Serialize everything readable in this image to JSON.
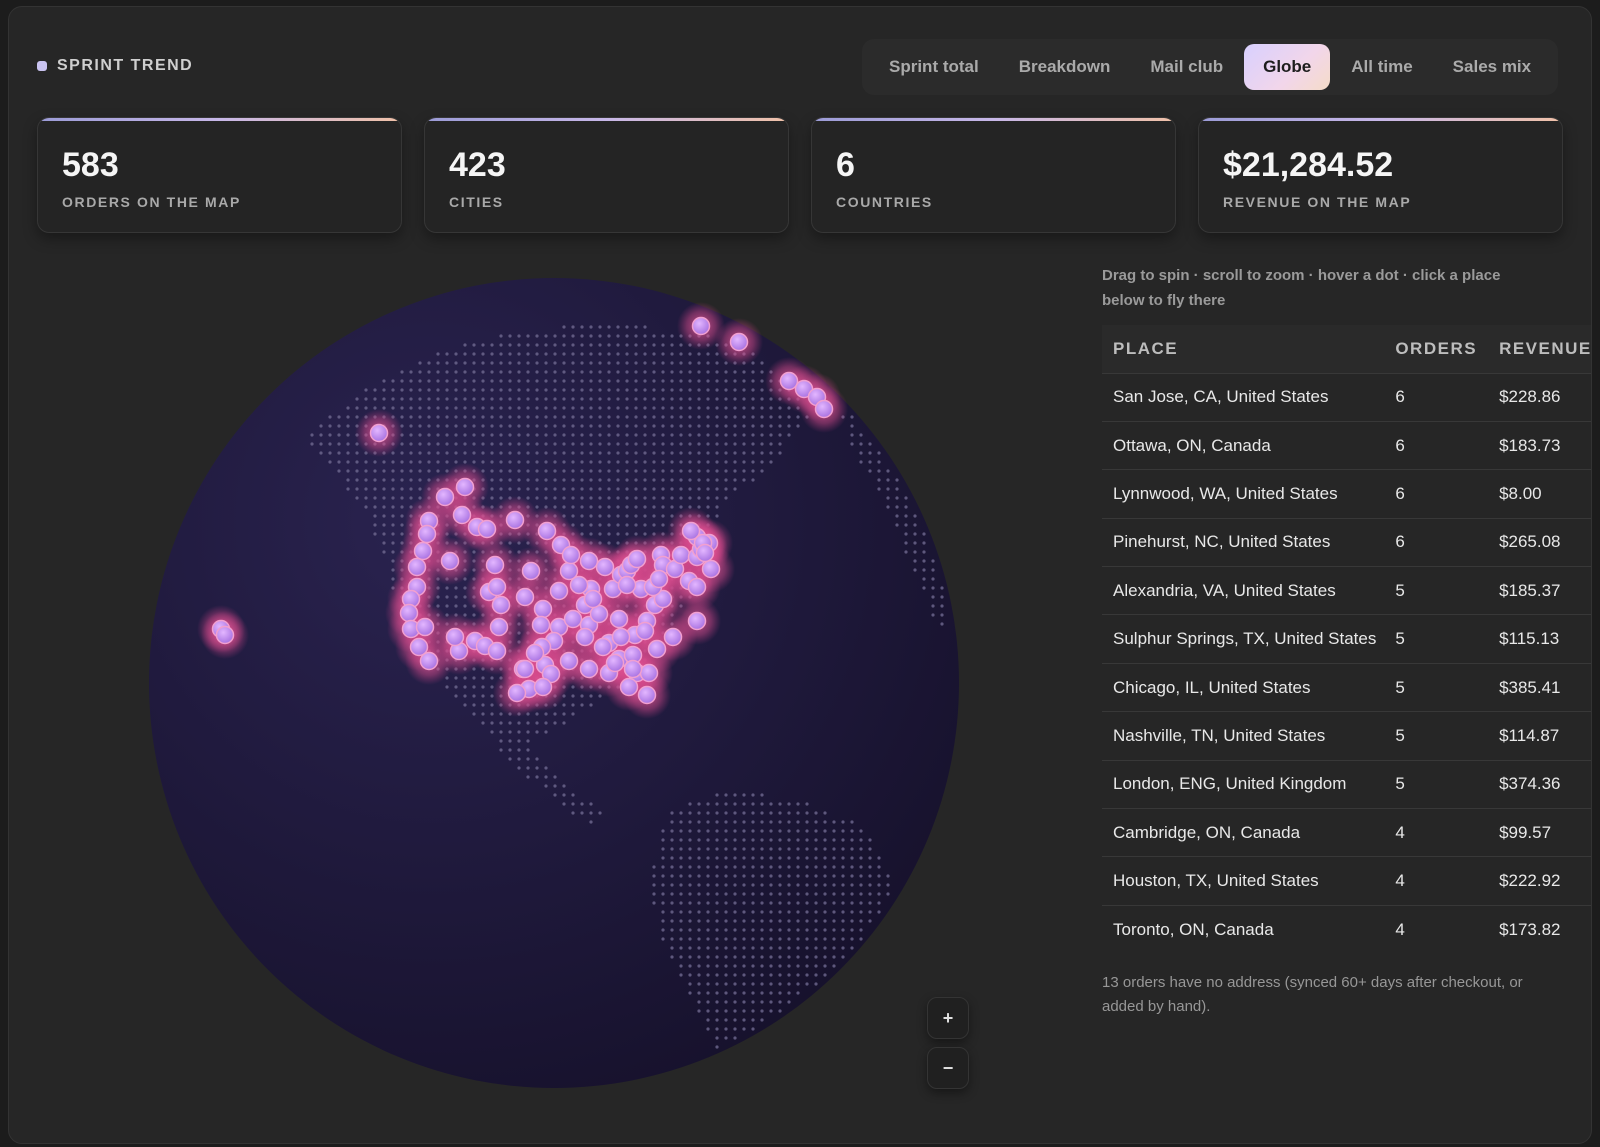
{
  "header": {
    "title": "SPRINT TREND"
  },
  "tabs": [
    {
      "label": "Sprint total",
      "active": false
    },
    {
      "label": "Breakdown",
      "active": false
    },
    {
      "label": "Mail club",
      "active": false
    },
    {
      "label": "Globe",
      "active": true
    },
    {
      "label": "All time",
      "active": false
    },
    {
      "label": "Sales mix",
      "active": false
    }
  ],
  "stats": [
    {
      "value": "583",
      "label": "ORDERS ON THE MAP"
    },
    {
      "value": "423",
      "label": "CITIES"
    },
    {
      "value": "6",
      "label": "COUNTRIES"
    },
    {
      "value": "$21,284.52",
      "label": "REVENUE ON THE MAP"
    }
  ],
  "globe": {
    "hint": "Drag to spin · scroll to zoom · hover a dot · click a place below to fly there",
    "zoom_in": "+",
    "zoom_out": "−",
    "colors": {
      "ocean": "#1e1838",
      "land_dots": "#6f6990",
      "marker": "#c487f0",
      "marker_glow": "#f05aa0"
    }
  },
  "table": {
    "columns": [
      "PLACE",
      "ORDERS",
      "REVENUE"
    ],
    "rows": [
      {
        "place": "San Jose, CA, United States",
        "orders": "6",
        "revenue": "$228.86"
      },
      {
        "place": "Ottawa, ON, Canada",
        "orders": "6",
        "revenue": "$183.73"
      },
      {
        "place": "Lynnwood, WA, United States",
        "orders": "6",
        "revenue": "$8.00"
      },
      {
        "place": "Pinehurst, NC, United States",
        "orders": "6",
        "revenue": "$265.08"
      },
      {
        "place": "Alexandria, VA, United States",
        "orders": "5",
        "revenue": "$185.37"
      },
      {
        "place": "Sulphur Springs, TX, United States",
        "orders": "5",
        "revenue": "$115.13"
      },
      {
        "place": "Chicago, IL, United States",
        "orders": "5",
        "revenue": "$385.41"
      },
      {
        "place": "Nashville, TN, United States",
        "orders": "5",
        "revenue": "$114.87"
      },
      {
        "place": "London, ENG, United Kingdom",
        "orders": "5",
        "revenue": "$374.36"
      },
      {
        "place": "Cambridge, ON, Canada",
        "orders": "4",
        "revenue": "$99.57"
      },
      {
        "place": "Houston, TX, United States",
        "orders": "4",
        "revenue": "$222.92"
      },
      {
        "place": "Toronto, ON, Canada",
        "orders": "4",
        "revenue": "$173.82"
      }
    ]
  },
  "footnote": "13 orders have no address (synced 60+ days after checkout, or added by hand)."
}
